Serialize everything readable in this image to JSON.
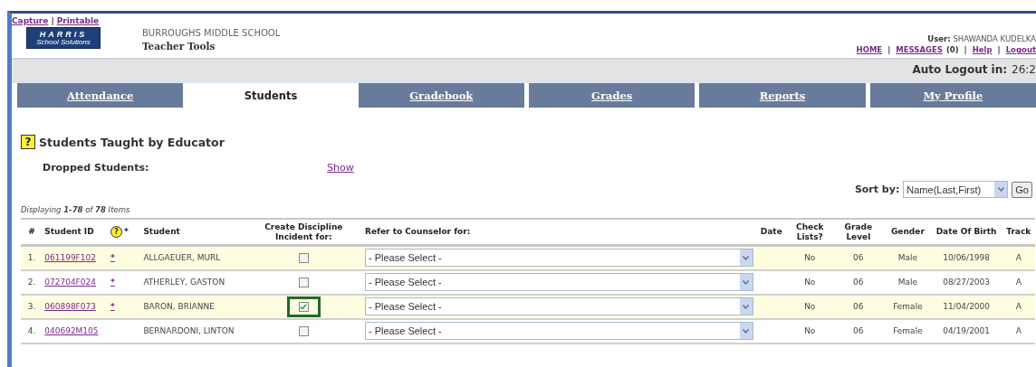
{
  "header_links": {
    "separator": "|",
    "items": [
      {
        "label": "Capture"
      },
      {
        "label": "Printable"
      }
    ]
  },
  "logo": {
    "line1": "HARRIS",
    "line2": "School Solutions"
  },
  "school": {
    "name": "BURROUGHS MIDDLE SCHOOL",
    "app": "Teacher Tools"
  },
  "user": {
    "label": "User:",
    "name": "SHAWANDA KUDELKA"
  },
  "nav": {
    "separator": "|",
    "items": [
      {
        "label": "HOME"
      },
      {
        "label": "MESSAGES",
        "suffix": "(0)"
      },
      {
        "label": "Help"
      },
      {
        "label": "Logout"
      }
    ]
  },
  "auto_logout": {
    "label": "Auto Logout in:",
    "value": "26:2"
  },
  "tabs": [
    {
      "label": "Attendance",
      "selected": false
    },
    {
      "label": "Students",
      "selected": true
    },
    {
      "label": "Gradebook",
      "selected": false
    },
    {
      "label": "Grades",
      "selected": false
    },
    {
      "label": "Reports",
      "selected": false
    },
    {
      "label": "My Profile",
      "selected": false
    }
  ],
  "section": {
    "help_icon": "?",
    "title": "Students Taught by Educator"
  },
  "dropped": {
    "label": "Dropped Students:",
    "link": "Show"
  },
  "sort": {
    "label": "Sort by:",
    "value": "Name(Last,First)",
    "button": "Go"
  },
  "displaying": "Displaying **1-78** of **78** Items",
  "table": {
    "columns": [
      {
        "label": "#"
      },
      {
        "label": "Student ID"
      },
      {
        "label": "*",
        "icon": "?"
      },
      {
        "label": "Student"
      },
      {
        "label": "Create Discipline Incident for:"
      },
      {
        "label": "Refer to Counselor for:"
      },
      {
        "label": "Date"
      },
      {
        "label": "Check Lists?"
      },
      {
        "label": "Grade Level"
      },
      {
        "label": "Gender"
      },
      {
        "label": "Date Of Birth"
      },
      {
        "label": "Track"
      }
    ],
    "rows": [
      {
        "number": "1.",
        "student_id": "061199F102",
        "flag": "*",
        "student": "ALLGAEUER, MURL",
        "discipline_checked": false,
        "callout": false,
        "counselor": "- Please Select -",
        "check_lists": "No",
        "grade_level": "06",
        "gender": "Male",
        "dob": "10/06/1998",
        "track": "A",
        "highlighted": true
      },
      {
        "number": "2.",
        "student_id": "072704F024",
        "flag": "*",
        "student": "ATHERLEY, GASTON",
        "discipline_checked": false,
        "callout": false,
        "counselor": "- Please Select -",
        "check_lists": "No",
        "grade_level": "06",
        "gender": "Male",
        "dob": "08/27/2003",
        "track": "A",
        "highlighted": false
      },
      {
        "number": "3.",
        "student_id": "060898F073",
        "flag": "*",
        "student": "BARON, BRIANNE",
        "discipline_checked": true,
        "callout": true,
        "counselor": "- Please Select -",
        "check_lists": "No",
        "grade_level": "06",
        "gender": "Female",
        "dob": "11/04/2000",
        "track": "A",
        "highlighted": true
      },
      {
        "number": "4.",
        "student_id": "040692M105",
        "student": "BERNARDONI, LINTON",
        "discipline_checked": false,
        "callout": false,
        "counselor": "- Please Select -",
        "check_lists": "No",
        "grade_level": "06",
        "gender": "Female",
        "dob": "04/19/2001",
        "track": "A",
        "highlighted": false
      }
    ]
  }
}
